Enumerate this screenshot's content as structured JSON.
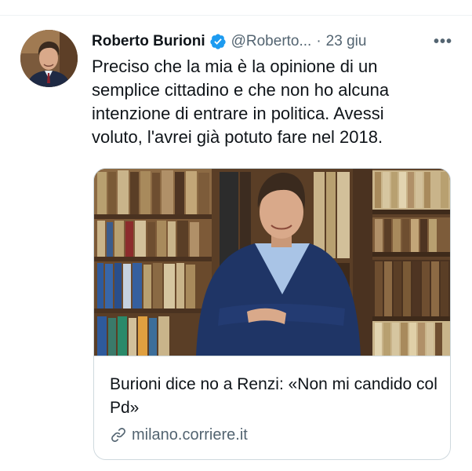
{
  "tweet": {
    "author_name": "Roberto Burioni",
    "handle": "@Roberto...",
    "separator": "·",
    "date": "23 giu",
    "more_icon": "more-horizontal-icon",
    "more_glyph": "•••",
    "verified_icon": "verified-badge-icon",
    "text": "Preciso che la mia è la opinione di un\nsemplice cittadino  e che non ho alcuna\nintenzione di entrare in politica. Avessi\nvoluto, l'avrei già potuto fare nel 2018."
  },
  "link_card": {
    "title": "Burioni dice no a Renzi: «Non mi candido col Pd»",
    "domain": "milano.corriere.it",
    "link_icon": "link-icon"
  },
  "colors": {
    "text_primary": "#0f1419",
    "text_secondary": "#536471",
    "verified_blue": "#1d9bf0",
    "border": "#cfd9de"
  }
}
